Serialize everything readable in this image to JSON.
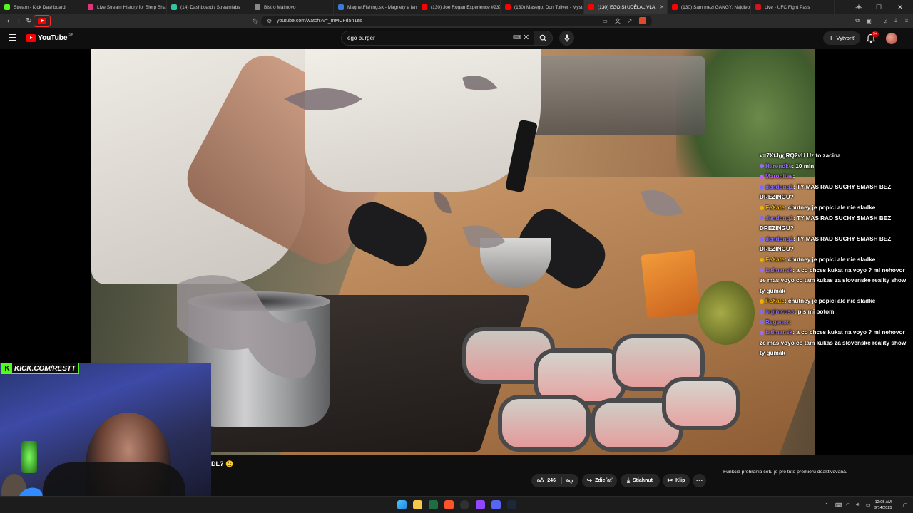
{
  "browser": {
    "tabs": [
      {
        "label": "Stream - Kick Dashboard",
        "color": "#53fc18"
      },
      {
        "label": "Live Stream History for Blerp Share",
        "color": "#e0357b"
      },
      {
        "label": "(14) Dashboard / Streamlabs",
        "color": "#31c3a2"
      },
      {
        "label": "Bistro Malinovo",
        "color": "#8a8a8a"
      },
      {
        "label": "MagnetFishing.sk - Magnety a lan",
        "color": "#3a7bd5"
      },
      {
        "label": "(130) Joe Rogan Experience #237",
        "color": "#ff0000"
      },
      {
        "label": "(130) Masego, Don Toliver - Myste",
        "color": "#ff0000"
      },
      {
        "label": "(130) EGO SI UDĚLAL VLA",
        "color": "#ff0000"
      },
      {
        "label": "(130) Sám mezi GANGY: Nejdivočé",
        "color": "#ff0000"
      },
      {
        "label": "Live - UFC Fight Pass",
        "color": "#d4141d"
      }
    ],
    "active_tab_index": 7,
    "url": "youtube.com/watch?v=_mMCFd5n1es"
  },
  "youtube": {
    "logo_text": "YouTube",
    "country_code": "SK",
    "search_value": "ego burger",
    "create_label": "Vytvoriť",
    "notification_badge": "9+"
  },
  "chat": {
    "lines": [
      {
        "user": "",
        "text": "v=7XtJggRQ2vU Uz to zacina",
        "user_color": "#ffffff"
      },
      {
        "user": "Harendke",
        "text": ": 10 min",
        "user_color": "#9b6bff"
      },
      {
        "user": "Maronites",
        "text": ":",
        "user_color": "#c15cff"
      },
      {
        "user": "dendonq1",
        "text": ": TY MAS RAD SUCHY SMASH BEZ DREZINGU?",
        "user_color": "#7d6bff"
      },
      {
        "user": "FeXate",
        "text": ": chutney je popici ale nie sladke",
        "user_color": "#f0b000"
      },
      {
        "user": "dendonq1",
        "text": ": TY MAS RAD SUCHY SMASH BEZ DREZINGU?",
        "user_color": "#7d6bff"
      },
      {
        "user": "dendonq1",
        "text": ": TY MAS RAD SUCHY SMASH BEZ DREZINGU?",
        "user_color": "#7d6bff"
      },
      {
        "user": "FeXate",
        "text": ": chutney je popici ale nie sladke",
        "user_color": "#f0b000"
      },
      {
        "user": "tadmansk",
        "text": ": a co chces kukat na voyo ? mi nehovor ze mas voyo co tam kukas za slovenske reality show ty gumak",
        "user_color": "#9b6bff"
      },
      {
        "user": "FeXate",
        "text": ": chutney je popici ale nie sladke",
        "user_color": "#f0b000"
      },
      {
        "user": "bujimcuss",
        "text": ": pis mi potom",
        "user_color": "#7d6bff"
      },
      {
        "user": "Regenor",
        "text": ":",
        "user_color": "#7d6bff"
      },
      {
        "user": "tadmansk",
        "text": ": a co chces kukat na voyo ? mi nehovor ze mas voyo co tam kukas za slovenske reality show ty gumak",
        "user_color": "#9b6bff"
      }
    ]
  },
  "webcam": {
    "kick_label": "KICK.COM/RESTT"
  },
  "video_info": {
    "title_fragment": "DL? 😩",
    "likes": "246",
    "share_label": "Zdieľať",
    "download_label": "Stiahnuť",
    "clip_label": "Klip",
    "premiere_message": "Funkcia prehrania četu je pre túto premiéru deaktivovaná."
  },
  "taskbar": {
    "time": "12:05 AM",
    "date": "9/14/2025"
  },
  "colors": {
    "yt_red": "#ff0000",
    "kick_green": "#53fc18"
  }
}
